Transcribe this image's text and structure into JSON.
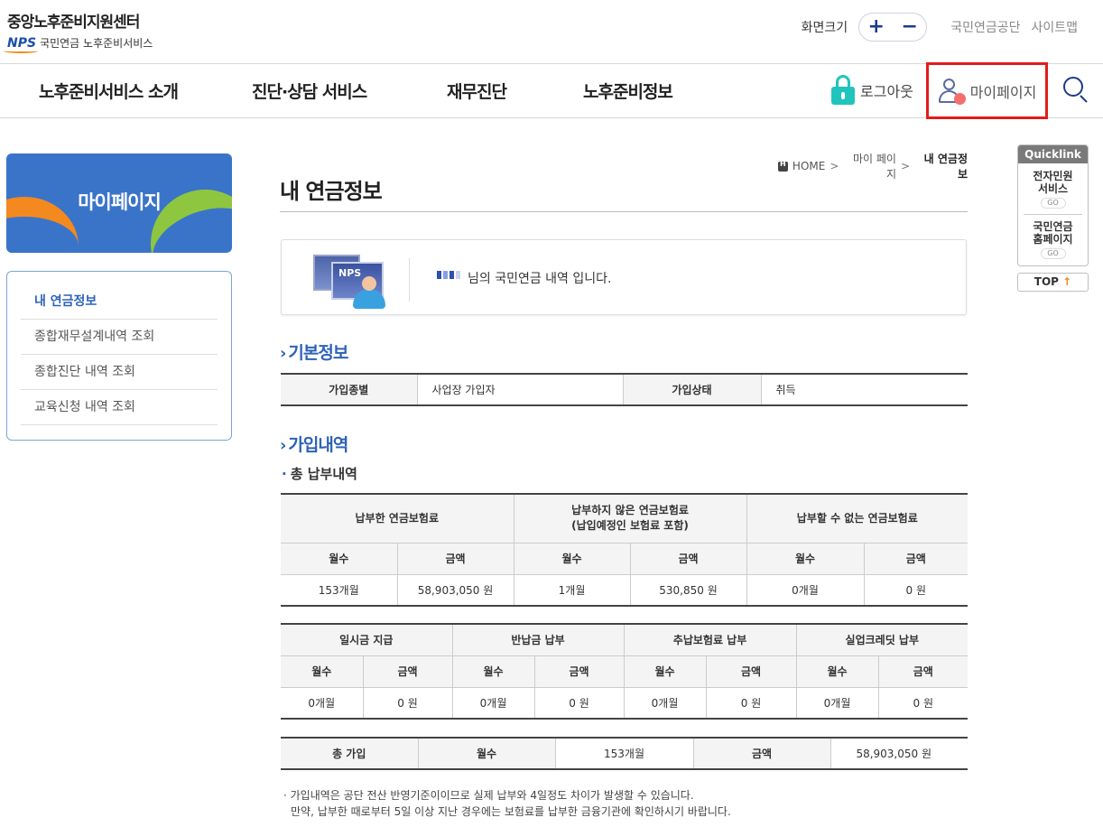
{
  "header": {
    "logo_title": "중앙노후준비지원센터",
    "logo_mark": "NPS",
    "logo_sub": "국민연금 노후준비서비스",
    "font_size_label": "화면크기",
    "font_plus": "+",
    "font_minus": "−",
    "util_links": [
      "국민연금공단",
      "사이트맵"
    ]
  },
  "nav": {
    "items": [
      "노후준비서비스 소개",
      "진단·상담 서비스",
      "재무진단",
      "노후준비정보"
    ],
    "logout": "로그아웃",
    "mypage": "마이페이지"
  },
  "sidebar": {
    "banner_title": "마이페이지",
    "items": [
      "내 연금정보",
      "종합재무설계내역 조회",
      "종합진단 내역 조회",
      "교육신청 내역 조회"
    ],
    "active_index": 0
  },
  "quicklink": {
    "title": "Quicklink",
    "items": [
      {
        "line1": "전자민원",
        "line2": "서비스",
        "go": "GO"
      },
      {
        "line1": "국민연금",
        "line2": "홈페이지",
        "go": "GO"
      }
    ],
    "top": "TOP",
    "top_arrow": "↑"
  },
  "breadcrumb": {
    "items": [
      "HOME",
      "마이 페이지",
      "내 연금정보"
    ],
    "sep": ">"
  },
  "page": {
    "title": "내 연금정보",
    "user_msg": "님의 국민연금 내역 입니다.",
    "illu_label": "NPS"
  },
  "basic": {
    "section_title": "기본정보",
    "row": [
      "가입종별",
      "사업장 가입자",
      "가입상태",
      "취득"
    ]
  },
  "enroll": {
    "section_title": "가입내역",
    "sub_title": "총 납부내역",
    "pay_table": {
      "groups": [
        "납부한 연금보험료",
        "납부하지 않은 연금보험료",
        "(납입예정인 보험료 포함)",
        "납부할 수 없는 연금보험료"
      ],
      "subheads": [
        "월수",
        "금액",
        "월수",
        "금액",
        "월수",
        "금액"
      ],
      "values": [
        "153개월",
        "58,903,050 원",
        "1개월",
        "530,850 원",
        "0개월",
        "0 원"
      ]
    },
    "etc_table": {
      "groups": [
        "일시금 지급",
        "반납금 납부",
        "추납보험료 납부",
        "실업크레딧 납부"
      ],
      "subheads": [
        "월수",
        "금액",
        "월수",
        "금액",
        "월수",
        "금액",
        "월수",
        "금액"
      ],
      "values": [
        "0개월",
        "0 원",
        "0개월",
        "0 원",
        "0개월",
        "0 원",
        "0개월",
        "0 원"
      ]
    },
    "total_table": {
      "cells": [
        "총 가입",
        "월수",
        "153개월",
        "금액",
        "58,903,050 원"
      ]
    },
    "notes": [
      "· 가입내역은 공단 전산 반영기준이이므로 실제 납부와 4일정도 차이가 발생할 수 있습니다.",
      "만약, 납부한 때로부터 5일 이상 지난 경우에는 보험료를 납부한 금융기관에 확인하시기 바랍니다."
    ]
  },
  "colors": {
    "accent_blue": "#2d62b7",
    "highlight_red": "#e41b1b",
    "lock_teal": "#21c4bd"
  }
}
